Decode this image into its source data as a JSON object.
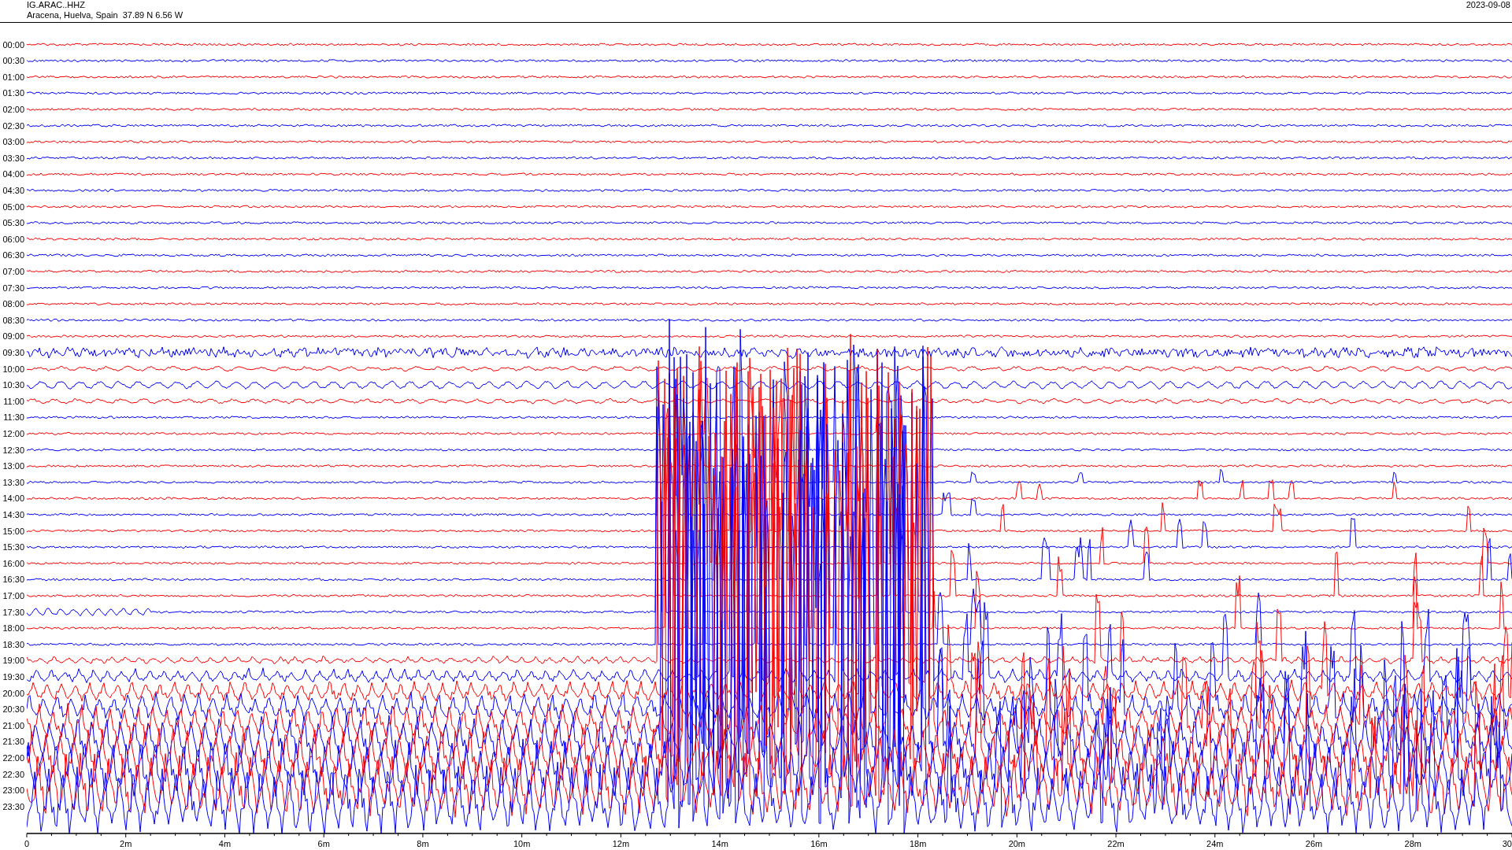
{
  "header": {
    "station": "IG.ARAC..HHZ",
    "location": "Aracena, Huelva, Spain  37.89 N 6.56 W",
    "date": "2023-09-08"
  },
  "rows": [
    {
      "label": "00:00"
    },
    {
      "label": "00:30"
    },
    {
      "label": "01:00"
    },
    {
      "label": "01:30"
    },
    {
      "label": "02:00"
    },
    {
      "label": "02:30"
    },
    {
      "label": "03:00"
    },
    {
      "label": "03:30"
    },
    {
      "label": "04:00"
    },
    {
      "label": "04:30"
    },
    {
      "label": "05:00"
    },
    {
      "label": "05:30"
    },
    {
      "label": "06:00"
    },
    {
      "label": "06:30"
    },
    {
      "label": "07:00"
    },
    {
      "label": "07:30"
    },
    {
      "label": "08:00"
    },
    {
      "label": "08:30"
    },
    {
      "label": "09:00"
    },
    {
      "label": "09:30"
    },
    {
      "label": "10:00"
    },
    {
      "label": "10:30"
    },
    {
      "label": "11:00"
    },
    {
      "label": "11:30"
    },
    {
      "label": "12:00"
    },
    {
      "label": "12:30"
    },
    {
      "label": "13:00"
    },
    {
      "label": "13:30"
    },
    {
      "label": "14:00"
    },
    {
      "label": "14:30"
    },
    {
      "label": "15:00"
    },
    {
      "label": "15:30"
    },
    {
      "label": "16:00"
    },
    {
      "label": "16:30"
    },
    {
      "label": "17:00"
    },
    {
      "label": "17:30"
    },
    {
      "label": "18:00"
    },
    {
      "label": "18:30"
    },
    {
      "label": "19:00"
    },
    {
      "label": "19:30"
    },
    {
      "label": "20:00"
    },
    {
      "label": "20:30"
    },
    {
      "label": "21:00"
    },
    {
      "label": "21:30"
    },
    {
      "label": "22:00"
    },
    {
      "label": "22:30"
    },
    {
      "label": "23:00"
    },
    {
      "label": "23:30"
    }
  ],
  "x_axis": {
    "ticks": [
      "0",
      "2m",
      "4m",
      "6m",
      "8m",
      "10m",
      "12m",
      "14m",
      "16m",
      "18m",
      "20m",
      "22m",
      "24m",
      "26m",
      "28m",
      "30"
    ]
  }
}
